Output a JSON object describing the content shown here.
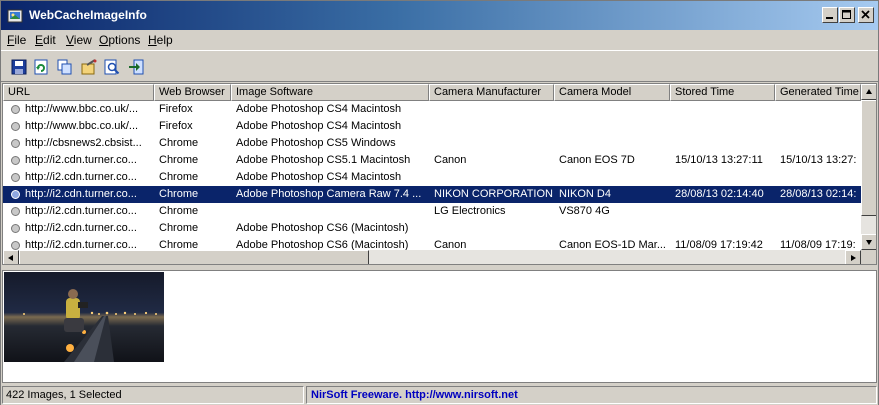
{
  "window": {
    "title": "WebCacheImageInfo",
    "controls": [
      "minimize-icon",
      "maximize-icon",
      "close-icon"
    ]
  },
  "menu": {
    "items": [
      {
        "label": "File",
        "mnemonic": "F",
        "rest": "ile"
      },
      {
        "label": "Edit",
        "mnemonic": "E",
        "rest": "dit"
      },
      {
        "label": "View",
        "mnemonic": "V",
        "rest": "iew"
      },
      {
        "label": "Options",
        "mnemonic": "O",
        "rest": "ptions"
      },
      {
        "label": "Help",
        "mnemonic": "H",
        "rest": "elp"
      }
    ]
  },
  "toolbar": {
    "icons": [
      "save-icon",
      "refresh-icon",
      "copy-icon",
      "properties-icon",
      "find-icon",
      "exit-icon"
    ]
  },
  "list": {
    "columns": [
      "URL",
      "Web Browser",
      "Image Software",
      "Camera Manufacturer",
      "Camera Model",
      "Stored Time",
      "Generated Time"
    ],
    "rows": [
      {
        "url": "http://www.bbc.co.uk/...",
        "browser": "Firefox",
        "software": "Adobe Photoshop CS4 Macintosh",
        "manufacturer": "",
        "model": "",
        "stored": "",
        "generated": "",
        "selected": false
      },
      {
        "url": "http://www.bbc.co.uk/...",
        "browser": "Firefox",
        "software": "Adobe Photoshop CS4 Macintosh",
        "manufacturer": "",
        "model": "",
        "stored": "",
        "generated": "",
        "selected": false
      },
      {
        "url": "http://cbsnews2.cbsist...",
        "browser": "Chrome",
        "software": "Adobe Photoshop CS5 Windows",
        "manufacturer": "",
        "model": "",
        "stored": "",
        "generated": "",
        "selected": false
      },
      {
        "url": "http://i2.cdn.turner.co...",
        "browser": "Chrome",
        "software": "Adobe Photoshop CS5.1 Macintosh",
        "manufacturer": "Canon",
        "model": "Canon EOS 7D",
        "stored": "15/10/13 13:27:11",
        "generated": "15/10/13 13:27:",
        "selected": false
      },
      {
        "url": "http://i2.cdn.turner.co...",
        "browser": "Chrome",
        "software": "Adobe Photoshop CS4 Macintosh",
        "manufacturer": "",
        "model": "",
        "stored": "",
        "generated": "",
        "selected": false
      },
      {
        "url": "http://i2.cdn.turner.co...",
        "browser": "Chrome",
        "software": "Adobe Photoshop Camera Raw 7.4 ...",
        "manufacturer": "NIKON CORPORATION",
        "model": "NIKON D4",
        "stored": "28/08/13 02:14:40",
        "generated": "28/08/13 02:14:",
        "selected": true
      },
      {
        "url": "http://i2.cdn.turner.co...",
        "browser": "Chrome",
        "software": "",
        "manufacturer": "LG Electronics",
        "model": "VS870 4G",
        "stored": "",
        "generated": "",
        "selected": false
      },
      {
        "url": "http://i2.cdn.turner.co...",
        "browser": "Chrome",
        "software": "Adobe Photoshop CS6 (Macintosh)",
        "manufacturer": "",
        "model": "",
        "stored": "",
        "generated": "",
        "selected": false
      },
      {
        "url": "http://i2.cdn.turner.co...",
        "browser": "Chrome",
        "software": "Adobe Photoshop CS6 (Macintosh)",
        "manufacturer": "Canon",
        "model": "Canon EOS-1D Mar...",
        "stored": "11/08/09 17:19:42",
        "generated": "11/08/09 17:19:",
        "selected": false
      }
    ]
  },
  "preview": {
    "image_subject": "photographer-at-night-runway"
  },
  "status": {
    "count": "422 Images, 1 Selected",
    "credit": "NirSoft Freeware.  http://www.nirsoft.net"
  },
  "colors": {
    "title_gradient_start": "#0a246a",
    "title_gradient_end": "#a6caf0",
    "selection": "#0a246a",
    "chrome": "#d4d0c8",
    "credit_text": "#0000c0"
  }
}
